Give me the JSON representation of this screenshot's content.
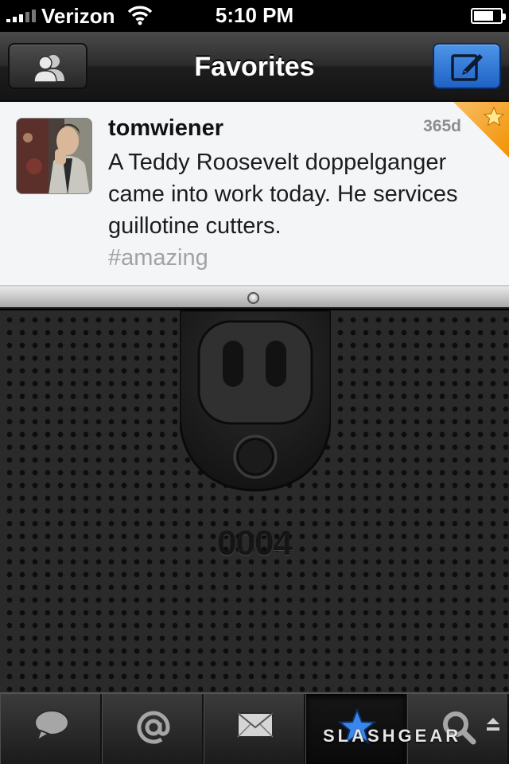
{
  "status_bar": {
    "carrier": "Verizon",
    "time": "5:10 PM",
    "battery_level": 0.6,
    "icons": [
      "signal-icon",
      "wifi-icon",
      "battery-icon"
    ]
  },
  "nav": {
    "title": "Favorites",
    "left_button_icon": "accounts-icon",
    "right_button_icon": "compose-icon"
  },
  "tweet": {
    "username": "tomwiener",
    "age": "365d",
    "text": "A Teddy Roosevelt doppelganger came into work today. He services guillotine cutters.",
    "hashtag": "#amazing",
    "favorited": true
  },
  "empty_state": {
    "count": "0004"
  },
  "tabs": [
    {
      "icon": "speech-bubble-icon",
      "name": "timeline",
      "active": false
    },
    {
      "icon": "at-sign-icon",
      "name": "mentions",
      "active": false
    },
    {
      "icon": "envelope-icon",
      "name": "messages",
      "active": false
    },
    {
      "icon": "star-icon",
      "name": "favorites",
      "active": true
    },
    {
      "icon": "search-icon",
      "name": "search",
      "active": false
    }
  ],
  "watermark": "SLASHGEAR",
  "colors": {
    "compose_blue": "#2a6fd1",
    "favorite_orange": "#f39200",
    "hashtag_gray": "#a2a2a2",
    "active_star_blue": "#3a86ea"
  }
}
